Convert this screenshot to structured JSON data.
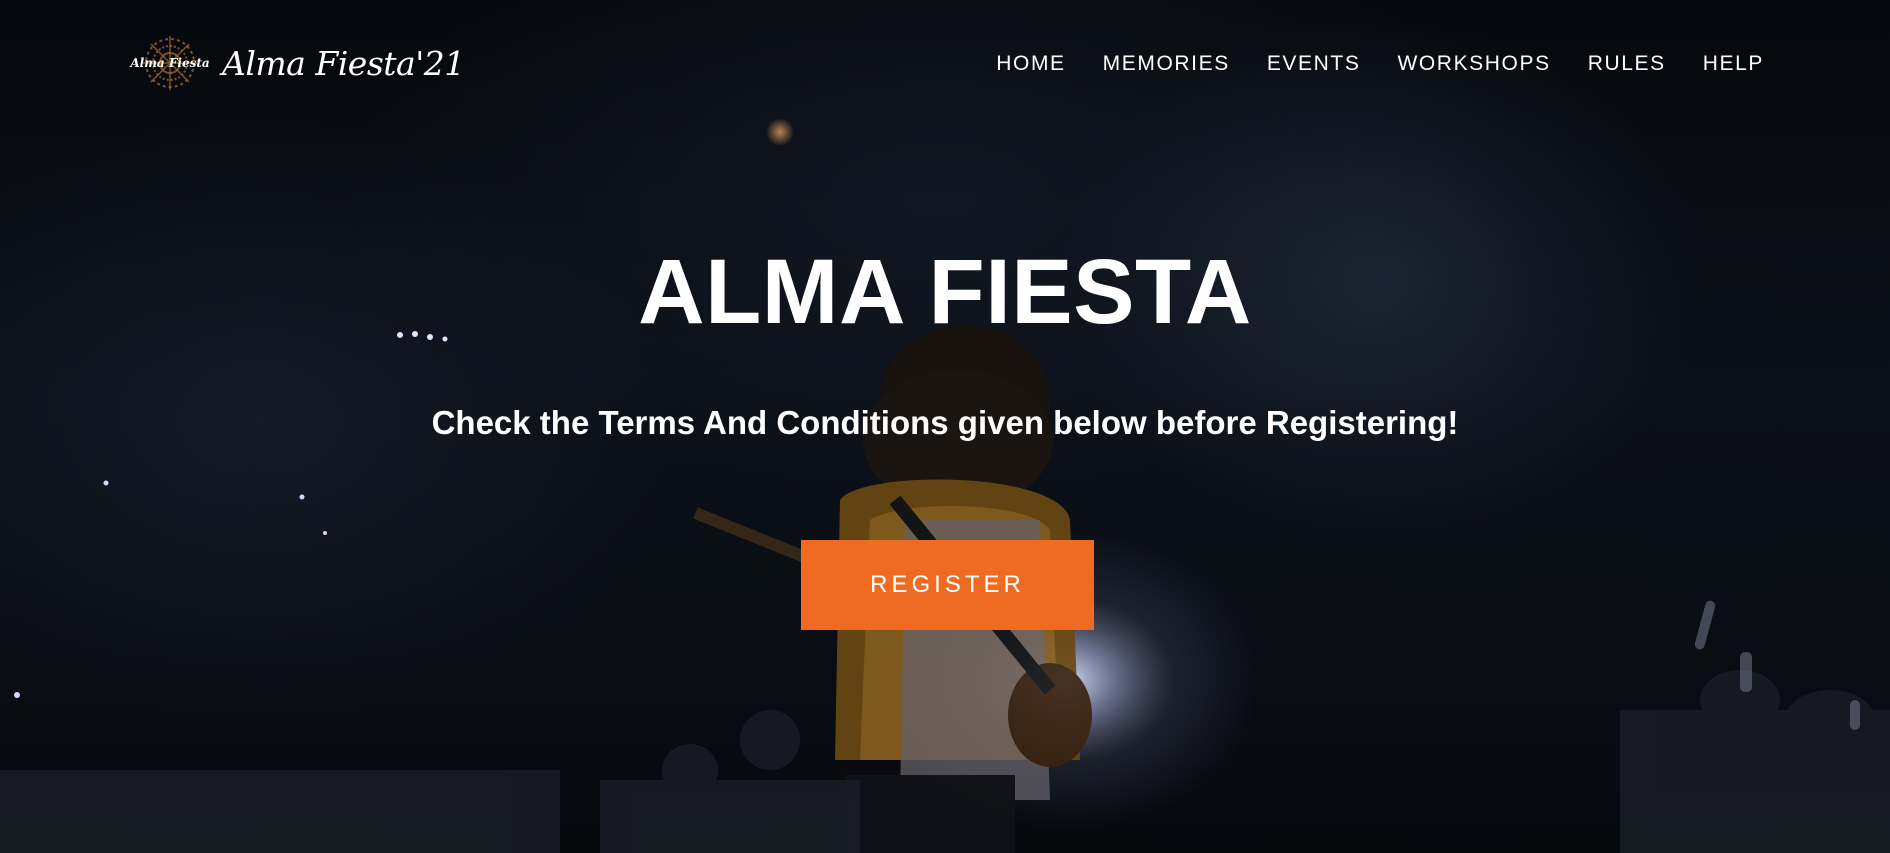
{
  "brand": {
    "logo_text": "Alma Fiesta",
    "title": "Alma Fiesta'21",
    "logo_icon": "mandala-logo-icon"
  },
  "nav": {
    "items": [
      {
        "label": "HOME"
      },
      {
        "label": "MEMORIES"
      },
      {
        "label": "EVENTS"
      },
      {
        "label": "WORKSHOPS"
      },
      {
        "label": "RULES"
      },
      {
        "label": "HELP"
      }
    ]
  },
  "hero": {
    "title": "ALMA FIESTA",
    "subtitle": "Check the Terms And Conditions given below before Registering!",
    "register_label": "REGISTER"
  },
  "colors": {
    "accent": "#ef6b21",
    "background": "#05070c",
    "text": "#ffffff"
  }
}
